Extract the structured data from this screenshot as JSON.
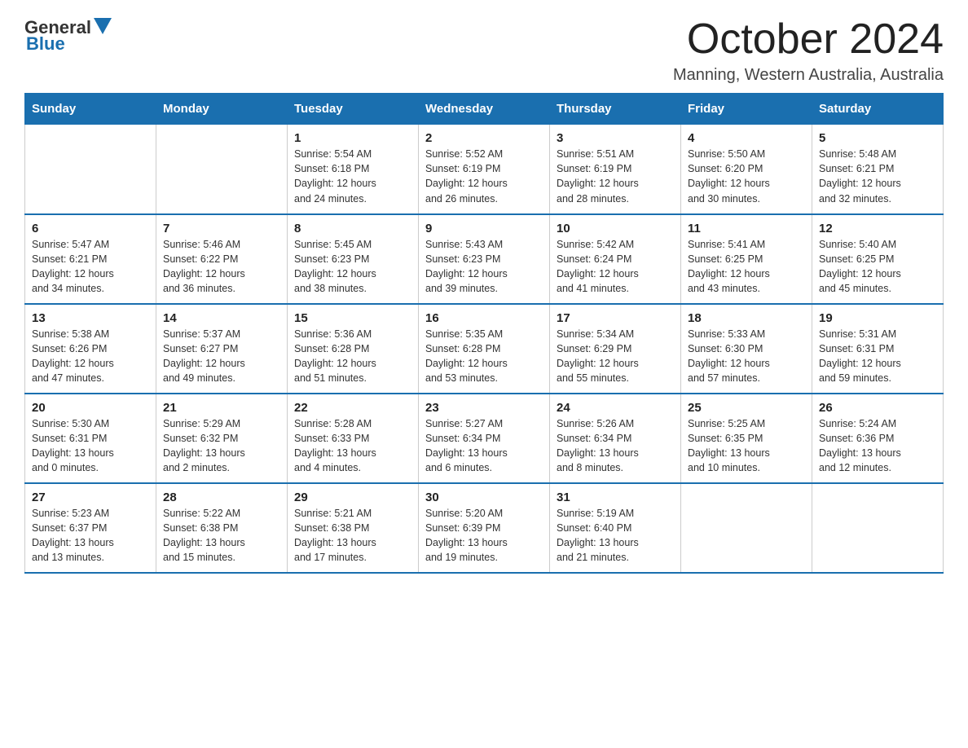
{
  "header": {
    "logo": {
      "text_general": "General",
      "text_blue": "Blue",
      "triangle_label": "logo-triangle"
    },
    "title": "October 2024",
    "location": "Manning, Western Australia, Australia"
  },
  "calendar": {
    "days_of_week": [
      "Sunday",
      "Monday",
      "Tuesday",
      "Wednesday",
      "Thursday",
      "Friday",
      "Saturday"
    ],
    "weeks": [
      [
        {
          "day": "",
          "info": ""
        },
        {
          "day": "",
          "info": ""
        },
        {
          "day": "1",
          "info": "Sunrise: 5:54 AM\nSunset: 6:18 PM\nDaylight: 12 hours\nand 24 minutes."
        },
        {
          "day": "2",
          "info": "Sunrise: 5:52 AM\nSunset: 6:19 PM\nDaylight: 12 hours\nand 26 minutes."
        },
        {
          "day": "3",
          "info": "Sunrise: 5:51 AM\nSunset: 6:19 PM\nDaylight: 12 hours\nand 28 minutes."
        },
        {
          "day": "4",
          "info": "Sunrise: 5:50 AM\nSunset: 6:20 PM\nDaylight: 12 hours\nand 30 minutes."
        },
        {
          "day": "5",
          "info": "Sunrise: 5:48 AM\nSunset: 6:21 PM\nDaylight: 12 hours\nand 32 minutes."
        }
      ],
      [
        {
          "day": "6",
          "info": "Sunrise: 5:47 AM\nSunset: 6:21 PM\nDaylight: 12 hours\nand 34 minutes."
        },
        {
          "day": "7",
          "info": "Sunrise: 5:46 AM\nSunset: 6:22 PM\nDaylight: 12 hours\nand 36 minutes."
        },
        {
          "day": "8",
          "info": "Sunrise: 5:45 AM\nSunset: 6:23 PM\nDaylight: 12 hours\nand 38 minutes."
        },
        {
          "day": "9",
          "info": "Sunrise: 5:43 AM\nSunset: 6:23 PM\nDaylight: 12 hours\nand 39 minutes."
        },
        {
          "day": "10",
          "info": "Sunrise: 5:42 AM\nSunset: 6:24 PM\nDaylight: 12 hours\nand 41 minutes."
        },
        {
          "day": "11",
          "info": "Sunrise: 5:41 AM\nSunset: 6:25 PM\nDaylight: 12 hours\nand 43 minutes."
        },
        {
          "day": "12",
          "info": "Sunrise: 5:40 AM\nSunset: 6:25 PM\nDaylight: 12 hours\nand 45 minutes."
        }
      ],
      [
        {
          "day": "13",
          "info": "Sunrise: 5:38 AM\nSunset: 6:26 PM\nDaylight: 12 hours\nand 47 minutes."
        },
        {
          "day": "14",
          "info": "Sunrise: 5:37 AM\nSunset: 6:27 PM\nDaylight: 12 hours\nand 49 minutes."
        },
        {
          "day": "15",
          "info": "Sunrise: 5:36 AM\nSunset: 6:28 PM\nDaylight: 12 hours\nand 51 minutes."
        },
        {
          "day": "16",
          "info": "Sunrise: 5:35 AM\nSunset: 6:28 PM\nDaylight: 12 hours\nand 53 minutes."
        },
        {
          "day": "17",
          "info": "Sunrise: 5:34 AM\nSunset: 6:29 PM\nDaylight: 12 hours\nand 55 minutes."
        },
        {
          "day": "18",
          "info": "Sunrise: 5:33 AM\nSunset: 6:30 PM\nDaylight: 12 hours\nand 57 minutes."
        },
        {
          "day": "19",
          "info": "Sunrise: 5:31 AM\nSunset: 6:31 PM\nDaylight: 12 hours\nand 59 minutes."
        }
      ],
      [
        {
          "day": "20",
          "info": "Sunrise: 5:30 AM\nSunset: 6:31 PM\nDaylight: 13 hours\nand 0 minutes."
        },
        {
          "day": "21",
          "info": "Sunrise: 5:29 AM\nSunset: 6:32 PM\nDaylight: 13 hours\nand 2 minutes."
        },
        {
          "day": "22",
          "info": "Sunrise: 5:28 AM\nSunset: 6:33 PM\nDaylight: 13 hours\nand 4 minutes."
        },
        {
          "day": "23",
          "info": "Sunrise: 5:27 AM\nSunset: 6:34 PM\nDaylight: 13 hours\nand 6 minutes."
        },
        {
          "day": "24",
          "info": "Sunrise: 5:26 AM\nSunset: 6:34 PM\nDaylight: 13 hours\nand 8 minutes."
        },
        {
          "day": "25",
          "info": "Sunrise: 5:25 AM\nSunset: 6:35 PM\nDaylight: 13 hours\nand 10 minutes."
        },
        {
          "day": "26",
          "info": "Sunrise: 5:24 AM\nSunset: 6:36 PM\nDaylight: 13 hours\nand 12 minutes."
        }
      ],
      [
        {
          "day": "27",
          "info": "Sunrise: 5:23 AM\nSunset: 6:37 PM\nDaylight: 13 hours\nand 13 minutes."
        },
        {
          "day": "28",
          "info": "Sunrise: 5:22 AM\nSunset: 6:38 PM\nDaylight: 13 hours\nand 15 minutes."
        },
        {
          "day": "29",
          "info": "Sunrise: 5:21 AM\nSunset: 6:38 PM\nDaylight: 13 hours\nand 17 minutes."
        },
        {
          "day": "30",
          "info": "Sunrise: 5:20 AM\nSunset: 6:39 PM\nDaylight: 13 hours\nand 19 minutes."
        },
        {
          "day": "31",
          "info": "Sunrise: 5:19 AM\nSunset: 6:40 PM\nDaylight: 13 hours\nand 21 minutes."
        },
        {
          "day": "",
          "info": ""
        },
        {
          "day": "",
          "info": ""
        }
      ]
    ]
  }
}
